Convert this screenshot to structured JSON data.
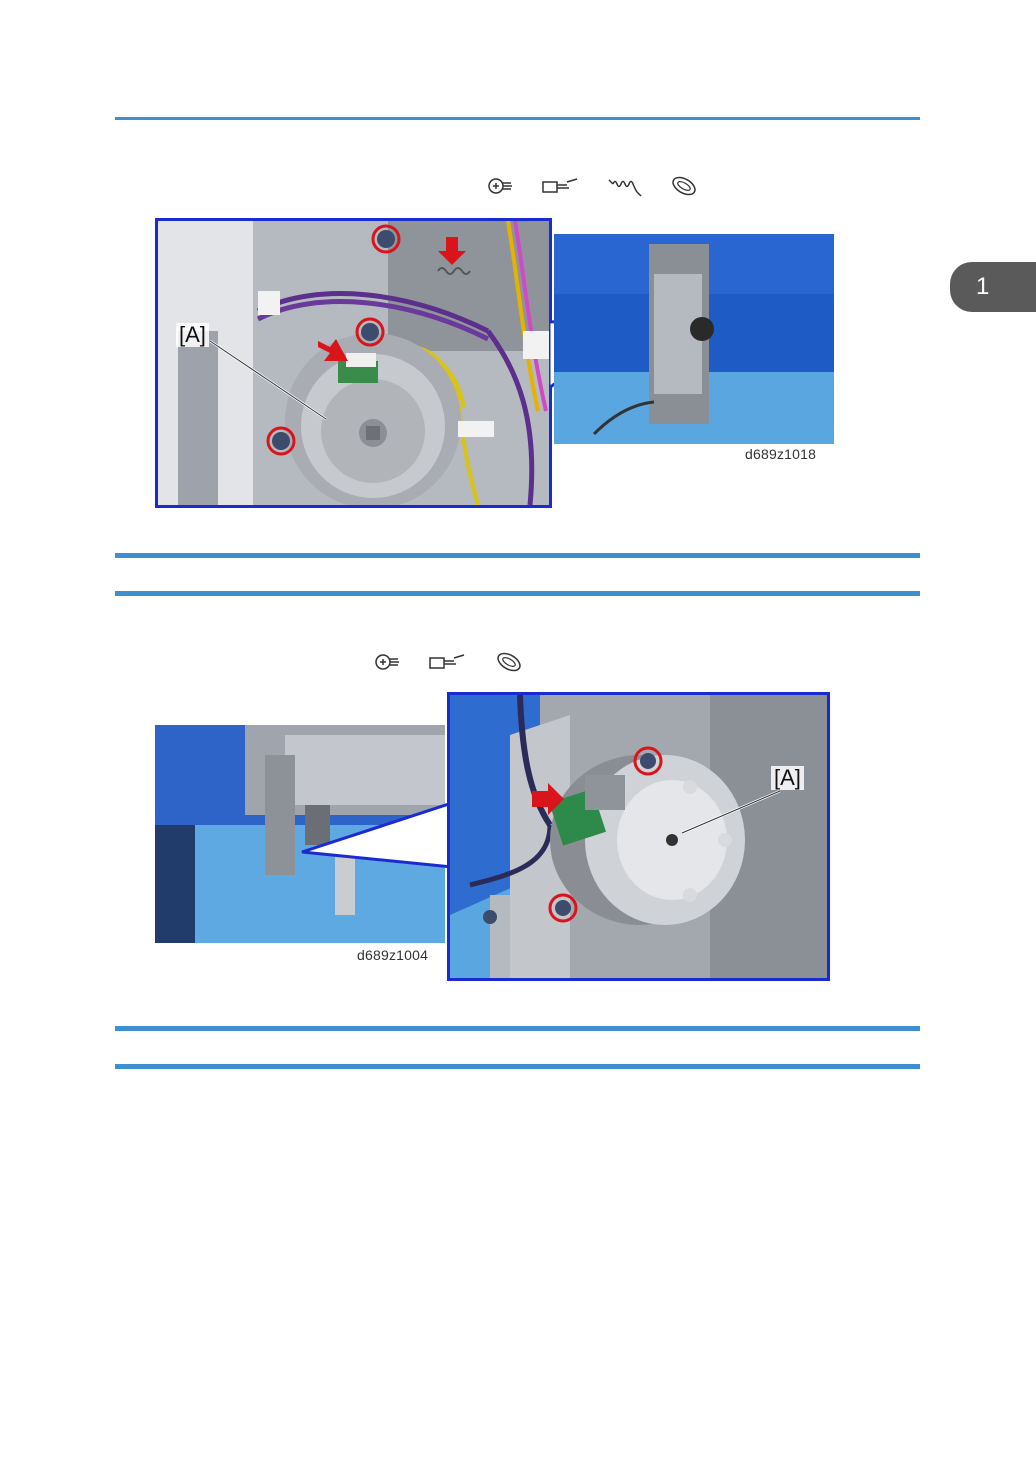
{
  "chapter_tab": {
    "number": "1"
  },
  "figure1": {
    "tool_icons": [
      "screw-icon",
      "connector-icon",
      "spring-icon",
      "harness-clamp-icon"
    ],
    "callout": "[A]",
    "image_id": "d689z1018"
  },
  "figure2": {
    "tool_icons": [
      "screw-icon",
      "connector-icon",
      "harness-clamp-icon"
    ],
    "callout": "[A]",
    "image_id": "d689z1004"
  },
  "colors": {
    "rule": "#3e8fd0",
    "frame": "#1a2ccf",
    "marker": "#d9141b",
    "tab": "#5a5a5a"
  }
}
